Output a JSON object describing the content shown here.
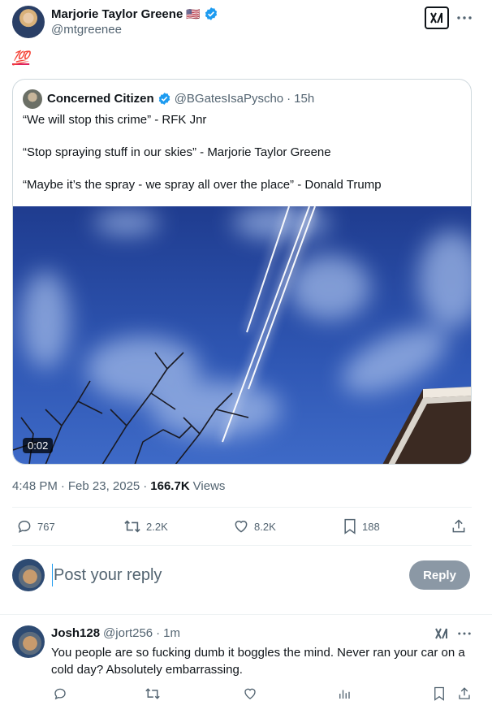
{
  "tweet": {
    "author_name": "Marjorie Taylor Greene",
    "author_flag": "🇺🇸",
    "author_handle": "@mtgreenee",
    "text": "💯",
    "time": "4:48 PM",
    "date": "Feb 23, 2025",
    "views_count": "166.7K",
    "views_label": "Views",
    "stats": {
      "replies": "767",
      "reposts": "2.2K",
      "likes": "8.2K",
      "bookmarks": "188"
    }
  },
  "quoted_tweet": {
    "author_name": "Concerned Citizen",
    "author_handle": "@BGatesIsaPyscho",
    "age": "15h",
    "lines": [
      "“We will stop this crime” - RFK Jnr",
      "“Stop spraying stuff in our skies” - Marjorie Taylor Greene",
      "“Maybe it’s the spray - we spray all over the place” - Donald Trump"
    ],
    "video_duration": "0:02"
  },
  "composer": {
    "placeholder": "Post your reply",
    "reply_button": "Reply"
  },
  "comment": {
    "author_name": "Josh128",
    "author_handle": "@jort256",
    "age": "1m",
    "text": "You people are so fucking dumb it boggles the mind.  Never ran your car on a cold day?  Absolutely embarrassing."
  },
  "colors": {
    "verified": "#1d9bf0",
    "text_muted": "#536471",
    "divider": "#eff3f4",
    "reply_button_disabled": "#8b98a5"
  },
  "icons": [
    "grok-icon",
    "more-icon",
    "verified-icon",
    "reply-icon",
    "repost-icon",
    "like-icon",
    "bookmark-icon",
    "share-icon",
    "views-icon"
  ]
}
